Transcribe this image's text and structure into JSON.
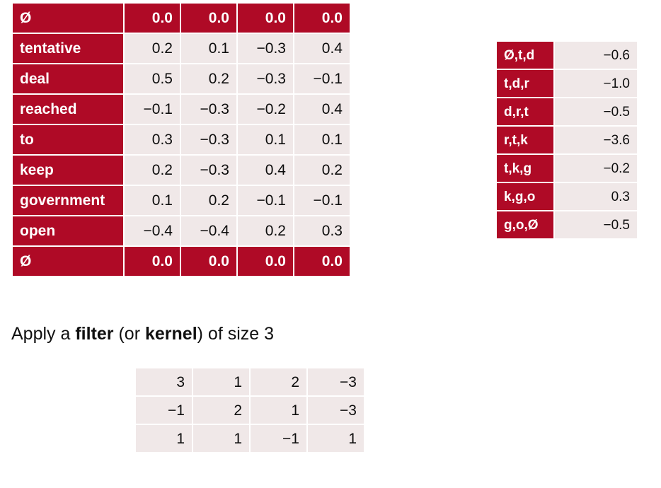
{
  "colors": {
    "accent_red": "#AF0A26",
    "cell_pink": "#F0E8E8",
    "text_dark": "#101010",
    "text_light": "#FFFFFF",
    "page_background": "#FFFFFF"
  },
  "embedding_table": {
    "rows": [
      {
        "label": "Ø",
        "kind": "pad",
        "values": [
          "0.0",
          "0.0",
          "0.0",
          "0.0"
        ]
      },
      {
        "label": "tentative",
        "kind": "data",
        "values": [
          "0.2",
          "0.1",
          "−0.3",
          "0.4"
        ]
      },
      {
        "label": "deal",
        "kind": "data",
        "values": [
          "0.5",
          "0.2",
          "−0.3",
          "−0.1"
        ]
      },
      {
        "label": "reached",
        "kind": "data",
        "values": [
          "−0.1",
          "−0.3",
          "−0.2",
          "0.4"
        ]
      },
      {
        "label": "to",
        "kind": "data",
        "values": [
          "0.3",
          "−0.3",
          "0.1",
          "0.1"
        ]
      },
      {
        "label": "keep",
        "kind": "data",
        "values": [
          "0.2",
          "−0.3",
          "0.4",
          "0.2"
        ]
      },
      {
        "label": "government",
        "kind": "data",
        "values": [
          "0.1",
          "0.2",
          "−0.1",
          "−0.1"
        ]
      },
      {
        "label": "open",
        "kind": "data",
        "values": [
          "−0.4",
          "−0.4",
          "0.2",
          "0.3"
        ]
      },
      {
        "label": "Ø",
        "kind": "pad",
        "values": [
          "0.0",
          "0.0",
          "0.0",
          "0.0"
        ]
      }
    ]
  },
  "scores_table": {
    "rows": [
      {
        "label": "Ø,t,d",
        "value": "−0.6"
      },
      {
        "label": "t,d,r",
        "value": "−1.0"
      },
      {
        "label": "d,r,t",
        "value": "−0.5"
      },
      {
        "label": "r,t,k",
        "value": "−3.6"
      },
      {
        "label": "t,k,g",
        "value": "−0.2"
      },
      {
        "label": "k,g,o",
        "value": "0.3"
      },
      {
        "label": "g,o,Ø",
        "value": "−0.5"
      }
    ]
  },
  "caption": {
    "part1": "Apply a ",
    "bold1": "filter",
    "part2": " (or ",
    "bold2": "kernel",
    "part3": ") of size 3"
  },
  "filter_table": {
    "rows": [
      [
        "3",
        "1",
        "2",
        "−3"
      ],
      [
        "−1",
        "2",
        "1",
        "−3"
      ],
      [
        "1",
        "1",
        "−1",
        "1"
      ]
    ]
  }
}
